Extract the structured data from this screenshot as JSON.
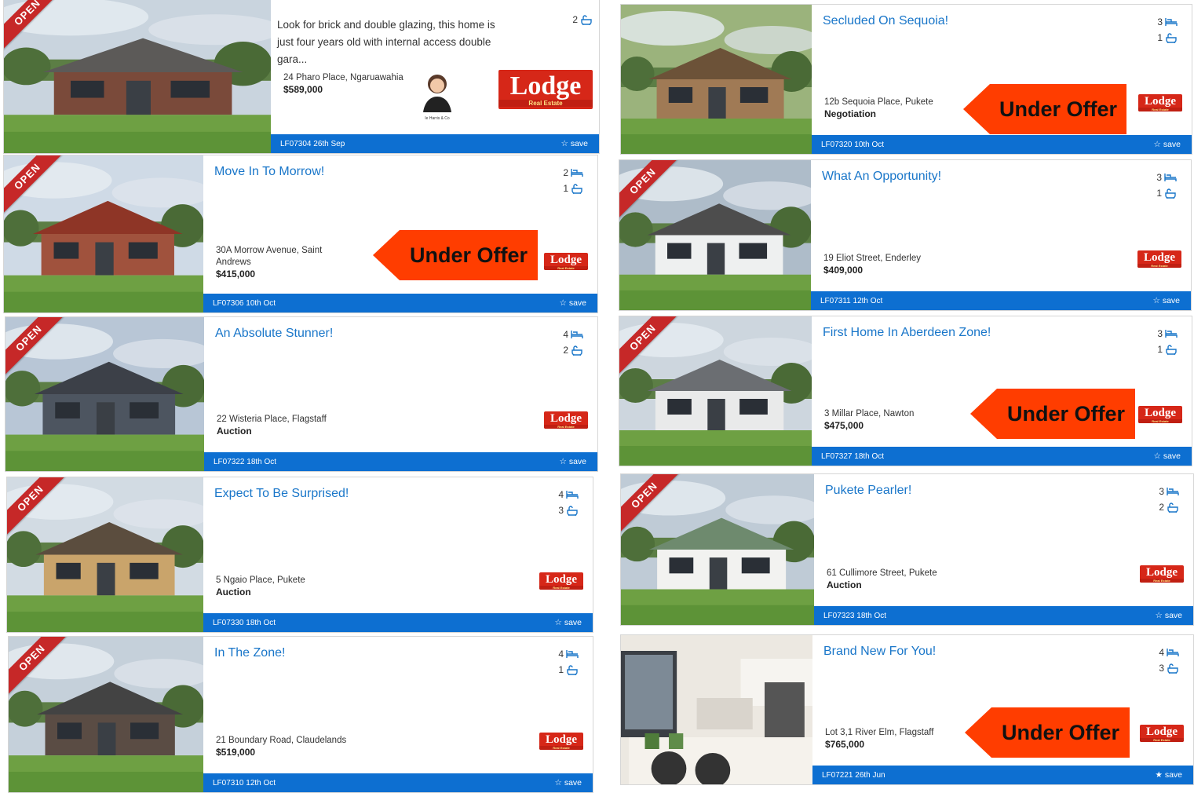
{
  "common": {
    "open_label": "OPEN",
    "save_label": "☆ save",
    "save_label_active": "★ save",
    "under_offer_label": "Under Offer"
  },
  "listings": [
    {
      "title": "",
      "desc": "Look for brick and double glazing, this home is just four years old with internal access double gara...",
      "beds": "",
      "baths": "2",
      "address": "24 Pharo Place, Ngaruawahia",
      "price": "$589,000",
      "ref": "LF07304 26th Sep",
      "agent_brand": "Ie Harris & Co",
      "open": true,
      "under_offer": false
    },
    {
      "title": "Move In To Morrow!",
      "beds": "2",
      "baths": "1",
      "address": "30A Morrow Avenue, Saint Andrews",
      "price": "$415,000",
      "ref": "LF07306 10th Oct",
      "open": true,
      "under_offer": true
    },
    {
      "title": "An Absolute Stunner!",
      "beds": "4",
      "baths": "2",
      "address": "22 Wisteria Place, Flagstaff",
      "price": "Auction",
      "ref": "LF07322 18th Oct",
      "open": true,
      "under_offer": false
    },
    {
      "title": "Expect To Be Surprised!",
      "beds": "4",
      "baths": "3",
      "address": "5 Ngaio Place, Pukete",
      "price": "Auction",
      "ref": "LF07330 18th Oct",
      "open": true,
      "under_offer": false
    },
    {
      "title": "In The Zone!",
      "beds": "4",
      "baths": "1",
      "address": "21 Boundary Road, Claudelands",
      "price": "$519,000",
      "ref": "LF07310 12th Oct",
      "open": true,
      "under_offer": false
    },
    {
      "title": "Secluded On Sequoia!",
      "beds": "3",
      "baths": "1",
      "address": "12b Sequoia Place, Pukete",
      "price": "Negotiation",
      "ref": "LF07320 10th Oct",
      "open": false,
      "under_offer": true
    },
    {
      "title": "What An Opportunity!",
      "beds": "3",
      "baths": "1",
      "address": "19 Eliot Street, Enderley",
      "price": "$409,000",
      "ref": "LF07311 12th Oct",
      "open": true,
      "under_offer": false
    },
    {
      "title": "First Home In Aberdeen Zone!",
      "beds": "3",
      "baths": "1",
      "address": "3 Millar Place, Nawton",
      "price": "$475,000",
      "ref": "LF07327 18th Oct",
      "open": true,
      "under_offer": true
    },
    {
      "title": "Pukete Pearler!",
      "beds": "3",
      "baths": "2",
      "address": "61 Cullimore Street, Pukete",
      "price": "Auction",
      "ref": "LF07323 18th Oct",
      "open": true,
      "under_offer": false
    },
    {
      "title": "Brand New For You!",
      "beds": "4",
      "baths": "3",
      "address": "Lot 3,1 River Elm, Flagstaff",
      "price": "$765,000",
      "ref": "LF07221 26th Jun",
      "open": false,
      "under_offer": true
    }
  ],
  "brand": {
    "logo_text": "Lodge",
    "logo_sub": "Real Estate",
    "accent": "#0d6fd1",
    "title_color": "#1976c9",
    "logo_color": "#d62718",
    "offer_color": "#ff3d00",
    "ribbon_color": "#c62828"
  },
  "icons": {
    "beds": "bed-icon",
    "baths": "bath-icon",
    "save": "star-icon"
  }
}
